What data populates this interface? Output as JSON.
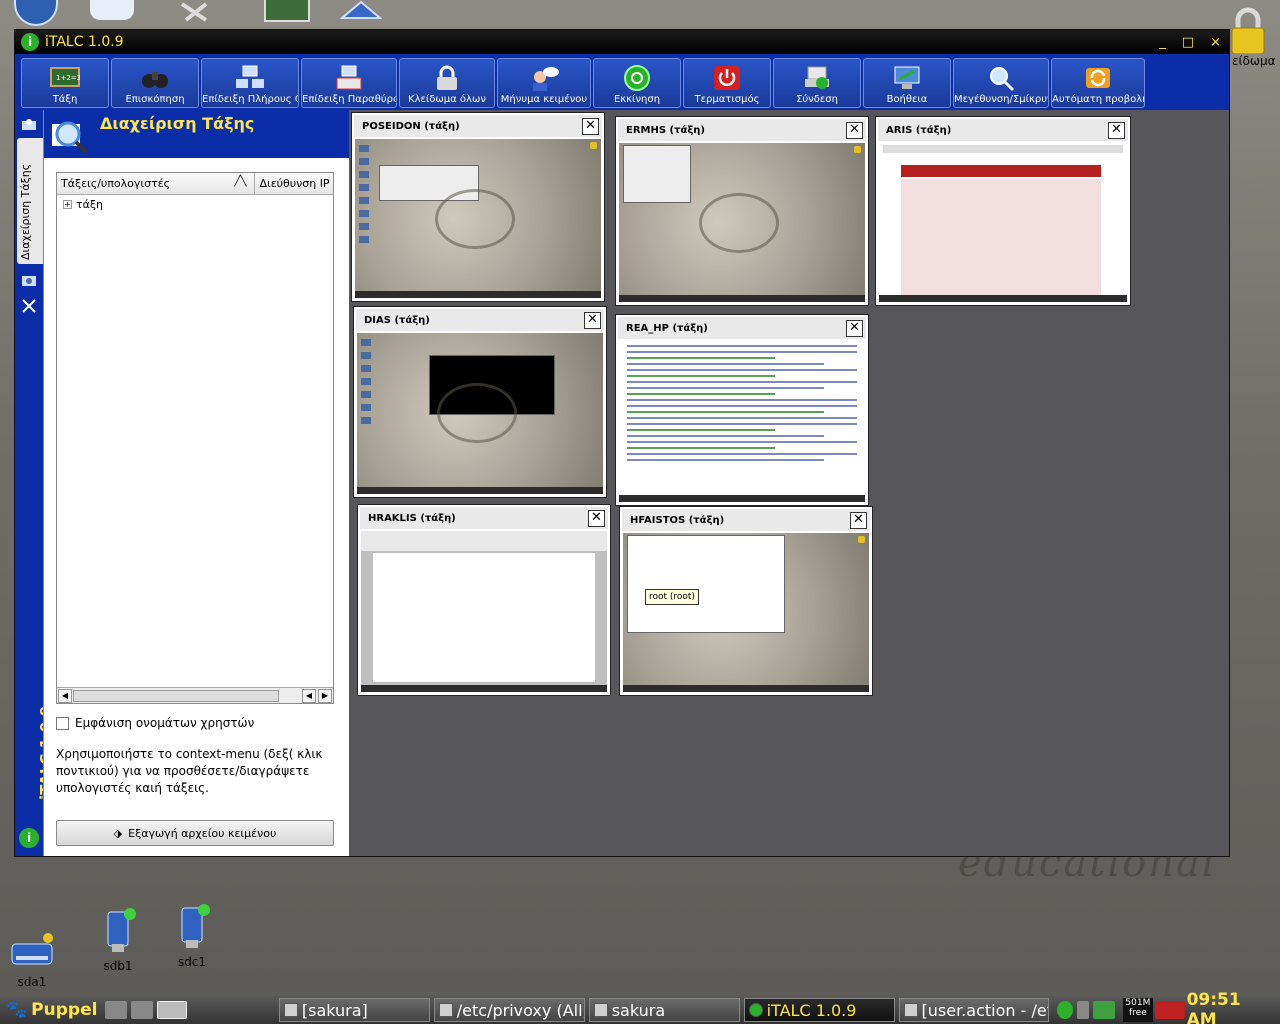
{
  "desktop": {
    "lock_label": "είδωμα",
    "watermark": "educational",
    "drives": [
      {
        "label": "sdb1"
      },
      {
        "label": "sdc1"
      },
      {
        "label": "sda1"
      }
    ]
  },
  "window": {
    "title": "iTALC 1.0.9",
    "buttons": {
      "minimize": "_",
      "maximize": "□",
      "close": "×"
    }
  },
  "toolbar": {
    "items": [
      {
        "label": "Τάξη",
        "icon": "classroom-icon"
      },
      {
        "label": "Επισκόπηση",
        "icon": "binoculars-icon"
      },
      {
        "label": "Επίδειξη Πλήρους Οθόνη",
        "icon": "fullscreen-demo-icon"
      },
      {
        "label": "Επίδειξη Παραθύρου",
        "icon": "window-demo-icon"
      },
      {
        "label": "Κλείδωμα όλων",
        "icon": "lock-icon"
      },
      {
        "label": "Μήνυμα κειμένου",
        "icon": "message-icon"
      },
      {
        "label": "Εκκίνηση",
        "icon": "power-on-icon"
      },
      {
        "label": "Τερματισμός",
        "icon": "power-off-icon"
      },
      {
        "label": "Σύνδεση",
        "icon": "login-icon"
      },
      {
        "label": "Βοήθεια",
        "icon": "help-icon"
      },
      {
        "label": "Μεγέθυνση/Σμίκρυνση/Ευθυγράμμιση",
        "icon": "zoom-icon"
      },
      {
        "label": "Αυτόματη προβολή",
        "icon": "auto-view-icon"
      }
    ]
  },
  "sidebar": {
    "active_tab": "Διαχείριση Τάξης",
    "brand": "iTALC 1.0.9"
  },
  "panel": {
    "title": "Διαχείριση Τάξης",
    "columns": [
      "Τάξεις/υπολογιστές",
      "Διεύθυνση IP"
    ],
    "tree": [
      {
        "label": "τάξη"
      }
    ],
    "show_usernames_label": "Εμφάνιση ονομάτων χρηστών",
    "help_text": "Χρησιμοποιήστε το context-menu (δεξ( κλικ ποντικιού) για να προσθέσετε/διαγράψετε υπολογιστές καιή τάξεις.",
    "export_button": "Εξαγωγή αρχείου κειμένου"
  },
  "monitors": [
    {
      "name": "POSEIDON (τάξη)",
      "screen": "desktop-menu"
    },
    {
      "name": "ERMHS (τάξη)",
      "screen": "desktop-list"
    },
    {
      "name": "ARIS (τάξη)",
      "screen": "soccer-site"
    },
    {
      "name": "DIAS (τάξη)",
      "screen": "desktop-terminal"
    },
    {
      "name": "REA_HP (τάξη)",
      "screen": "google-search"
    },
    {
      "name": "HRAKLIS (τάξη)",
      "screen": "word-processor"
    },
    {
      "name": "HFAISTOS (τάξη)",
      "screen": "desktop-editor",
      "tooltip": "root (root)"
    }
  ],
  "taskbar": {
    "start_label": "Puppel",
    "tasks": [
      {
        "label": "[sakura]"
      },
      {
        "label": "/etc/privoxy (All,"
      },
      {
        "label": "sakura"
      },
      {
        "label": "iTALC 1.0.9",
        "active": true
      },
      {
        "label": "[user.action - /et"
      }
    ],
    "memory": "501M free",
    "clock": "09:51 AM"
  },
  "colors": {
    "accent": "#0b2ea8",
    "title_text": "#ffe44a",
    "workspace": "#57565a"
  }
}
